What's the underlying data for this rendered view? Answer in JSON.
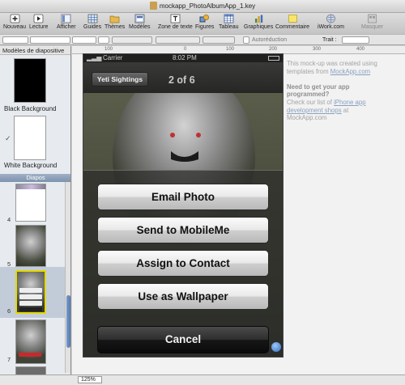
{
  "window": {
    "title": "mockapp_PhotoAlbumApp_1.key"
  },
  "toolbar": {
    "nouveau": "Nouveau",
    "lecture": "Lecture",
    "afficher": "Afficher",
    "guides": "Guides",
    "themes": "Thèmes",
    "modeles": "Modèles",
    "zone_texte": "Zone de texte",
    "figures": "Figures",
    "tableau": "Tableau",
    "graphiques": "Graphiques",
    "commentaire": "Commentaire",
    "iwork": "iWork.com",
    "masquer": "Masquer"
  },
  "format_bar": {
    "autoreduction": "Autoréduction",
    "trait": "Trait :"
  },
  "sidebar": {
    "header": "Modèles de diapositive",
    "masters": [
      {
        "label": "Black Background"
      },
      {
        "label": "White Background",
        "check": "✓"
      }
    ],
    "diapos_header": "Diapos",
    "slides": [
      "4",
      "5",
      "6",
      "7"
    ],
    "selected_slide": "6"
  },
  "ruler": {
    "marks": [
      "100",
      "0",
      "100",
      "200",
      "300",
      "400"
    ]
  },
  "notes": {
    "line1": "This mock-up was created using templates from",
    "link1": "MockApp.com",
    "heading": "Need to get your app programmed?",
    "line2": "Check our list of",
    "link2": "iPhone app development shops",
    "line3": "at",
    "link3": "MockApp.com"
  },
  "phone": {
    "status_left": "Carrier",
    "status_time": "8:02 PM",
    "back_label": "Yeti Sightings",
    "nav_title": "2 of 6",
    "actions": [
      "Email Photo",
      "Send to MobileMe",
      "Assign to Contact",
      "Use as Wallpaper"
    ],
    "cancel": "Cancel"
  },
  "status_bar": {
    "zoom": "125%"
  },
  "icons": {
    "nouveau": "plus-square-icon",
    "lecture": "play-icon",
    "afficher": "view-icon",
    "guides": "grid-icon",
    "themes": "folder-icon",
    "modeles": "layout-icon",
    "zone_texte": "text-box-icon",
    "figures": "shapes-icon",
    "tableau": "table-icon",
    "graphiques": "chart-icon",
    "commentaire": "note-icon",
    "iwork": "globe-icon",
    "masquer": "inspector-icon"
  }
}
